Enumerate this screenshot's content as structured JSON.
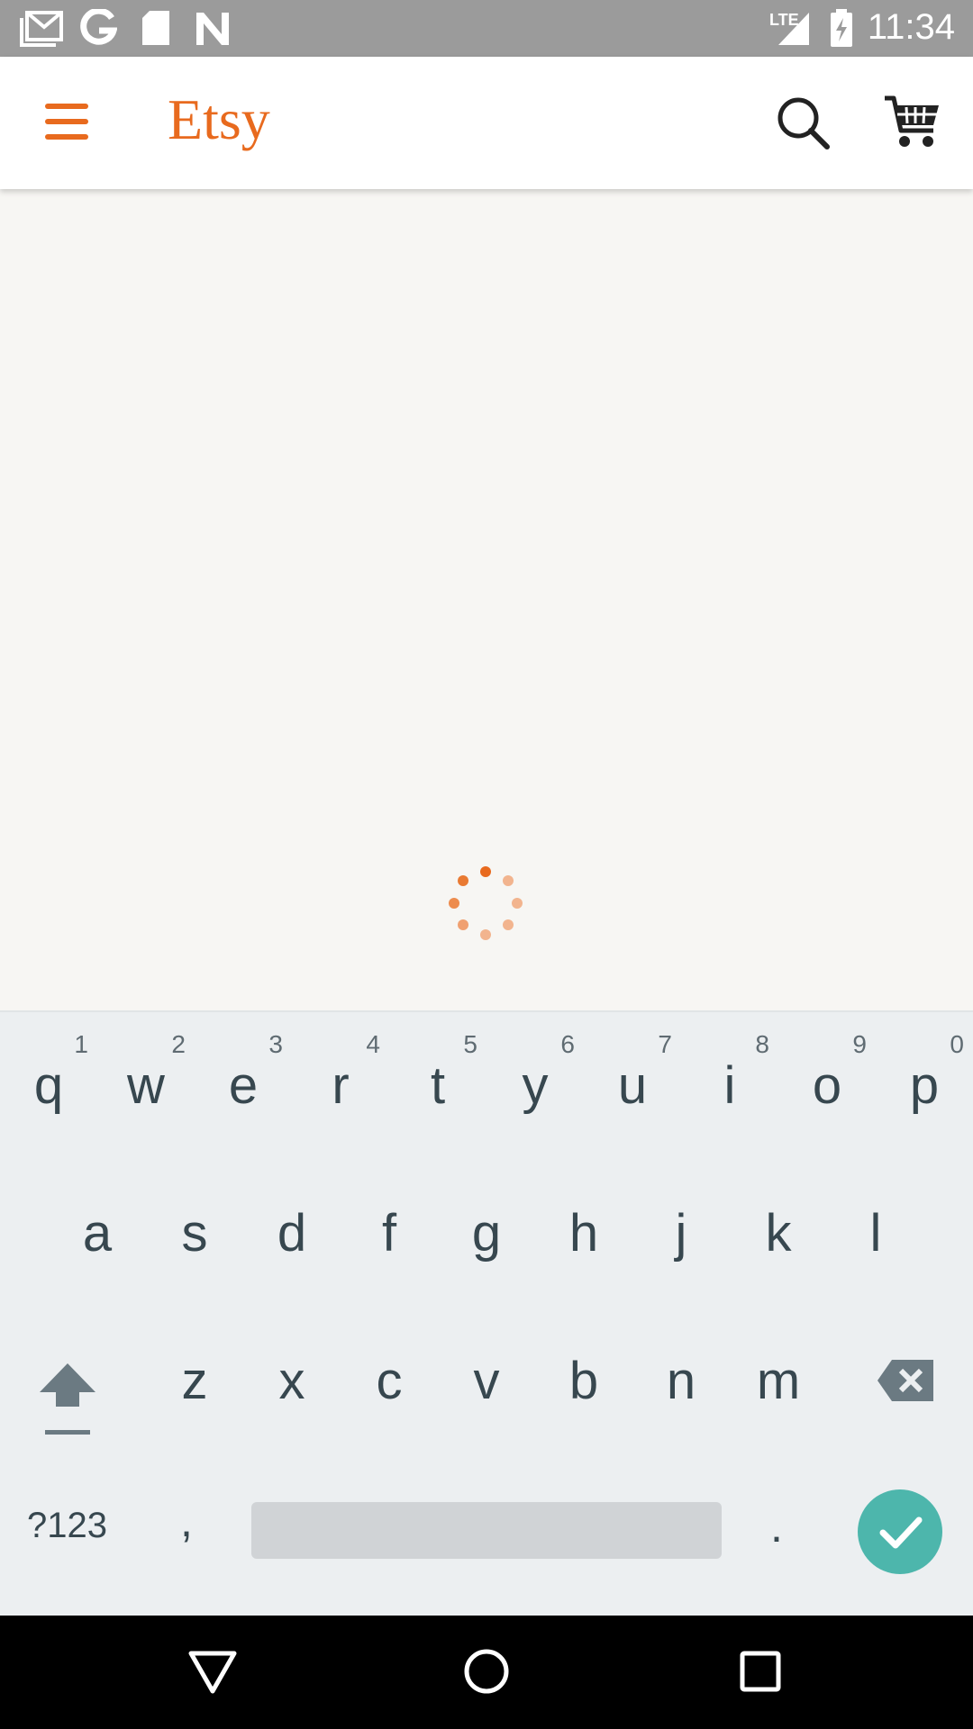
{
  "status_bar": {
    "time": "11:34",
    "network": "LTE",
    "icons": [
      "gmail-icon",
      "google-icon",
      "sd-card-icon",
      "n-icon",
      "lte-signal-icon",
      "battery-charging-icon"
    ]
  },
  "app_bar": {
    "logo_text": "Etsy",
    "brand_color": "#e86a1e",
    "icons": [
      "menu-icon",
      "search-icon",
      "cart-icon"
    ]
  },
  "keyboard": {
    "row1": [
      {
        "key": "q",
        "num": "1"
      },
      {
        "key": "w",
        "num": "2"
      },
      {
        "key": "e",
        "num": "3"
      },
      {
        "key": "r",
        "num": "4"
      },
      {
        "key": "t",
        "num": "5"
      },
      {
        "key": "y",
        "num": "6"
      },
      {
        "key": "u",
        "num": "7"
      },
      {
        "key": "i",
        "num": "8"
      },
      {
        "key": "o",
        "num": "9"
      },
      {
        "key": "p",
        "num": "0"
      }
    ],
    "row2": [
      "a",
      "s",
      "d",
      "f",
      "g",
      "h",
      "j",
      "k",
      "l"
    ],
    "row3": [
      "z",
      "x",
      "c",
      "v",
      "b",
      "n",
      "m"
    ],
    "symbols_label": "?123",
    "comma_label": ",",
    "period_label": ".",
    "accent_color": "#4db6ac"
  },
  "nav_bar": {
    "icons": [
      "back-icon",
      "home-icon",
      "recents-icon"
    ]
  }
}
